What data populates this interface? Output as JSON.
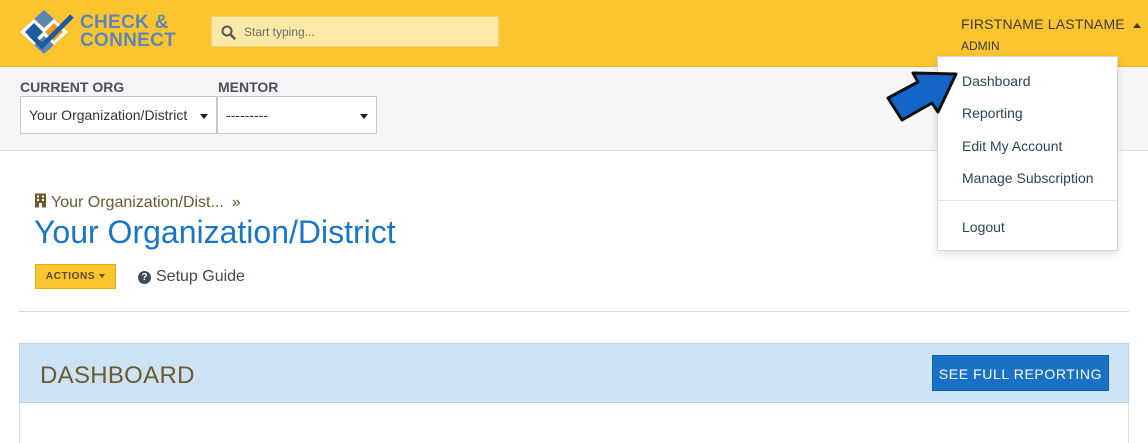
{
  "header": {
    "logo_line1": "CHECK &",
    "logo_line2": "CONNECT",
    "search_placeholder": "Start typing...",
    "user_name": "FIRSTNAME LASTNAME",
    "user_role": "ADMIN"
  },
  "filters": {
    "org_label": "CURRENT ORG",
    "org_value": "Your Organization/District",
    "mentor_label": "MENTOR",
    "mentor_value": "---------"
  },
  "page": {
    "breadcrumb": "Your Organization/Dist...",
    "breadcrumb_sep": "»",
    "title": "Your Organization/District",
    "actions_label": "ACTIONS",
    "setup_guide_label": "Setup Guide"
  },
  "dashboard": {
    "title": "DASHBOARD",
    "full_report_label": "SEE FULL REPORTING"
  },
  "user_menu": {
    "items": [
      "Dashboard",
      "Reporting",
      "Edit My Account",
      "Manage Subscription"
    ],
    "logout": "Logout"
  },
  "colors": {
    "brand_yellow": "#fcc52f",
    "brand_blue": "#1976c7",
    "panel_blue": "#cde2f5"
  },
  "icons": {
    "search": "search-icon",
    "building": "building-icon",
    "help": "question-circle-icon",
    "pointer": "pointer-arrow-icon"
  }
}
